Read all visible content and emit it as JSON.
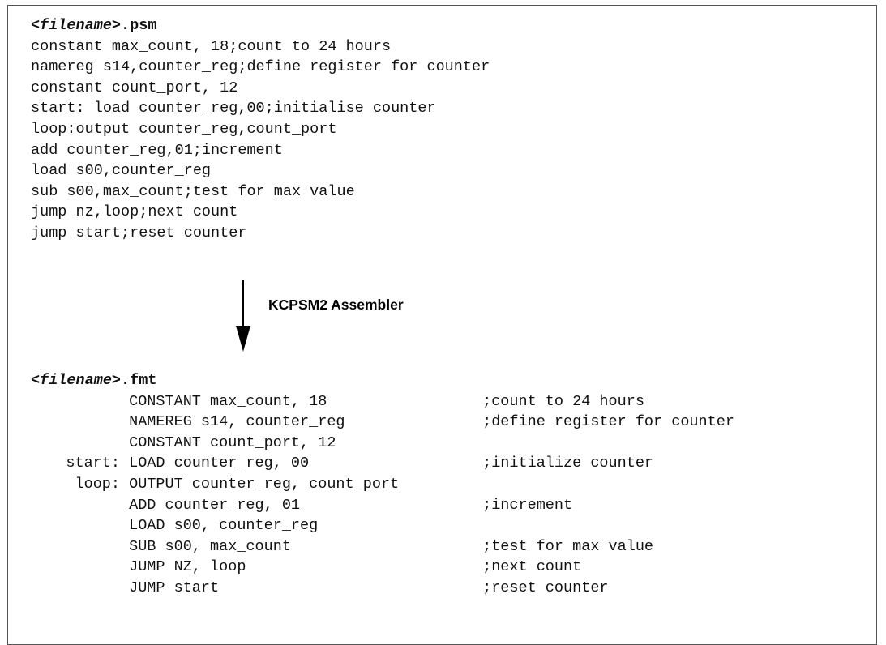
{
  "psm": {
    "filename_placeholder": "<filename>",
    "extension": ".psm",
    "lines": [
      "constant max_count, 18;count to 24 hours",
      "namereg s14,counter_reg;define register for counter",
      "constant count_port, 12",
      "start: load counter_reg,00;initialise counter",
      "loop:output counter_reg,count_port",
      "add counter_reg,01;increment",
      "load s00,counter_reg",
      "sub s00,max_count;test for max value",
      "jump nz,loop;next count",
      "jump start;reset counter"
    ]
  },
  "arrow": {
    "label": "KCPSM2 Assembler"
  },
  "fmt": {
    "filename_placeholder": "<filename>",
    "extension": ".fmt",
    "lines": [
      {
        "label": "",
        "instr": "CONSTANT max_count, 18",
        "comment": ";count to 24 hours"
      },
      {
        "label": "",
        "instr": "NAMEREG s14, counter_reg",
        "comment": ";define register for counter"
      },
      {
        "label": "",
        "instr": "CONSTANT count_port, 12",
        "comment": ""
      },
      {
        "label": "start:",
        "instr": "LOAD counter_reg, 00",
        "comment": ";initialize counter"
      },
      {
        "label": "loop:",
        "instr": "OUTPUT counter_reg, count_port",
        "comment": ""
      },
      {
        "label": "",
        "instr": "ADD counter_reg, 01",
        "comment": ";increment"
      },
      {
        "label": "",
        "instr": "LOAD s00, counter_reg",
        "comment": ""
      },
      {
        "label": "",
        "instr": "SUB s00, max_count",
        "comment": ";test for max value"
      },
      {
        "label": "",
        "instr": "JUMP NZ, loop",
        "comment": ";next count"
      },
      {
        "label": "",
        "instr": "JUMP start",
        "comment": ";reset counter"
      }
    ]
  }
}
